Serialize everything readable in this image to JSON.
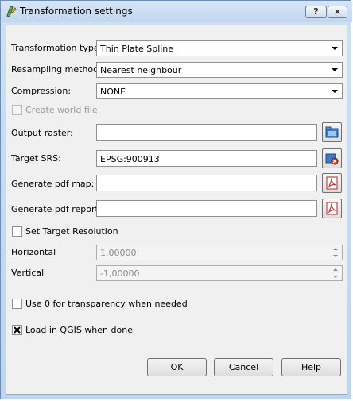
{
  "window": {
    "title": "Transformation settings",
    "help_label": "?",
    "close_label": "×"
  },
  "form": {
    "transformation_type": {
      "label": "Transformation type:",
      "value": "Thin Plate Spline"
    },
    "resampling_method": {
      "label": "Resampling method:",
      "value": "Nearest neighbour"
    },
    "compression": {
      "label": "Compression:",
      "value": "NONE"
    },
    "create_world_file": {
      "label": "Create world file",
      "checked": false,
      "enabled": false
    },
    "output_raster": {
      "label": "Output raster:",
      "value": ""
    },
    "target_srs": {
      "label": "Target SRS:",
      "value": "EPSG:900913"
    },
    "pdf_map": {
      "label": "Generate pdf map:",
      "value": ""
    },
    "pdf_report": {
      "label": "Generate pdf report:",
      "value": ""
    },
    "set_target_resolution": {
      "label": "Set Target Resolution",
      "checked": false
    },
    "horizontal": {
      "label": "Horizontal",
      "value": "1,00000"
    },
    "vertical": {
      "label": "Vertical",
      "value": "-1,00000"
    },
    "transparency": {
      "label": "Use 0 for transparency when needed",
      "checked": false
    },
    "load_in_qgis": {
      "label": "Load in QGIS when done",
      "checked": true
    }
  },
  "buttons": {
    "ok": "OK",
    "cancel": "Cancel",
    "help": "Help"
  },
  "icons": {
    "window_icon": "qgis-georeferencer-icon",
    "output_raster": "folder-browse-icon",
    "target_srs": "projection-select-icon",
    "pdf_map": "pdf-icon",
    "pdf_report": "pdf-icon"
  }
}
